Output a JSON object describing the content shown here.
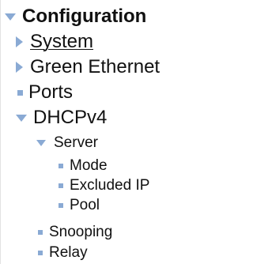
{
  "tree": {
    "items": [
      {
        "label": "Configuration",
        "level": 0,
        "marker": "expanded",
        "link": false
      },
      {
        "label": "System",
        "level": 1,
        "marker": "collapsed",
        "link": true
      },
      {
        "label": "Green Ethernet",
        "level": 1,
        "marker": "collapsed",
        "link": false
      },
      {
        "label": "Ports",
        "level": 1,
        "marker": "leaf",
        "link": false
      },
      {
        "label": "DHCPv4",
        "level": 1,
        "marker": "expanded",
        "link": false
      },
      {
        "label": "Server",
        "level": 2,
        "marker": "expanded",
        "link": false
      },
      {
        "label": "Mode",
        "level": 3,
        "marker": "leaf",
        "link": false
      },
      {
        "label": "Excluded IP",
        "level": 3,
        "marker": "leaf",
        "link": false
      },
      {
        "label": "Pool",
        "level": 3,
        "marker": "leaf",
        "link": false
      },
      {
        "label": "Snooping",
        "level": 2,
        "marker": "leaf",
        "link": false
      },
      {
        "label": "Relay",
        "level": 2,
        "marker": "leaf",
        "link": false
      }
    ]
  },
  "colors": {
    "expanded_arrow": "#8aaad4",
    "collapsed_arrow": "#8aaad4",
    "leaf_bullet": "#8aaad4",
    "text": "#111111"
  },
  "icons": {
    "expanded": "triangle-down-icon",
    "collapsed": "triangle-right-icon",
    "leaf": "square-bullet-icon"
  }
}
